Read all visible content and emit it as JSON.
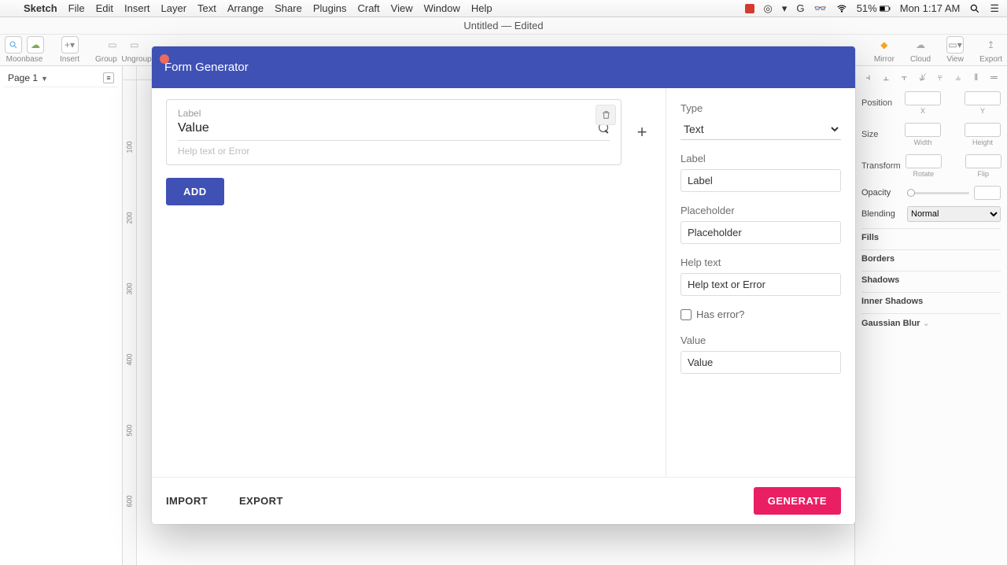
{
  "menubar": {
    "app": "Sketch",
    "items": [
      "File",
      "Edit",
      "Insert",
      "Layer",
      "Text",
      "Arrange",
      "Share",
      "Plugins",
      "Craft",
      "View",
      "Window",
      "Help"
    ],
    "battery": "51%",
    "clock": "Mon 1:17 AM"
  },
  "window": {
    "title": "Untitled — Edited"
  },
  "toolbar": {
    "moonbase": "Moonbase",
    "insert": "Insert",
    "group": "Group",
    "ungroup": "Ungroup",
    "mirror": "Mirror",
    "cloud": "Cloud",
    "view": "View",
    "export": "Export"
  },
  "leftSidebar": {
    "page": "Page 1"
  },
  "rulerTicks": [
    100,
    200,
    300,
    400,
    500,
    600
  ],
  "inspector": {
    "position": "Position",
    "x": "X",
    "y": "Y",
    "size": "Size",
    "w": "Width",
    "h": "Height",
    "transform": "Transform",
    "rotate": "Rotate",
    "flip": "Flip",
    "opacity": "Opacity",
    "blending": "Blending",
    "blendVal": "Normal",
    "fills": "Fills",
    "borders": "Borders",
    "shadows": "Shadows",
    "inner": "Inner Shadows",
    "gauss": "Gaussian Blur"
  },
  "modal": {
    "title": "Form Generator",
    "field": {
      "label": "Label",
      "value": "Value",
      "help": "Help text or Error"
    },
    "addBtn": "ADD",
    "side": {
      "typeLabel": "Type",
      "typeVal": "Text",
      "labelLabel": "Label",
      "labelVal": "Label",
      "placeholderLabel": "Placeholder",
      "placeholderVal": "Placeholder",
      "helpLabel": "Help text",
      "helpVal": "Help text or Error",
      "hasError": "Has error?",
      "valueLabel": "Value",
      "valueVal": "Value"
    },
    "footer": {
      "import": "IMPORT",
      "export": "EXPORT",
      "generate": "GENERATE"
    }
  }
}
